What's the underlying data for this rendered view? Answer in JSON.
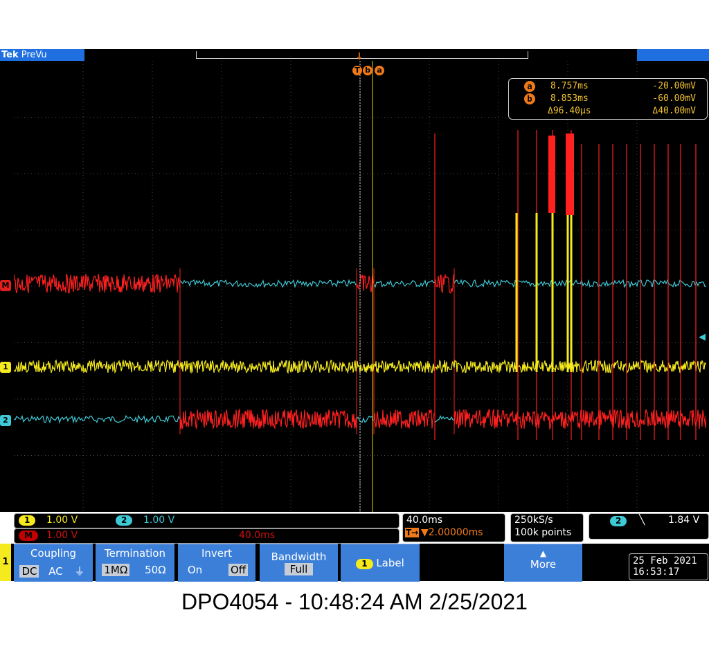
{
  "header": {
    "brand_tek": "Tek",
    "brand_mode": "PreVu"
  },
  "trigger_marker": {
    "label_t": "T",
    "cursor_b": "b",
    "cursor_a": "a"
  },
  "channel_markers": {
    "math": "M",
    "ch1": "1",
    "ch2": "2"
  },
  "cursor_readout": {
    "row_a": {
      "badge": "a",
      "time": "8.757ms",
      "volt": "-20.00mV"
    },
    "row_b": {
      "badge": "b",
      "time": "8.853ms",
      "volt": "-60.00mV"
    },
    "row_delta": {
      "time": "Δ96.40µs",
      "volt": "Δ40.00mV"
    }
  },
  "channel_info": {
    "ch1": {
      "badge": "1",
      "scale": "1.00 V"
    },
    "ch2": {
      "badge": "2",
      "scale": "1.00 V"
    },
    "math": {
      "badge": "M",
      "scale": "1.00 V",
      "time": "40.0ms"
    }
  },
  "timebase": {
    "scale": "40.0ms",
    "trigger_pos": "▼2.00000ms",
    "trigger_prefix": "T→"
  },
  "acquisition": {
    "rate": "250kS/s",
    "points": "100k points"
  },
  "trigger": {
    "channel": "2",
    "slope_icon": "╲",
    "level": "1.84 V"
  },
  "datetime": {
    "date": "25 Feb  2021",
    "time": "16:53:17"
  },
  "menu": {
    "channel_tab": "1",
    "coupling": {
      "title": "Coupling",
      "options": [
        "DC",
        "AC",
        "⏚"
      ],
      "selected": "DC"
    },
    "termination": {
      "title": "Termination",
      "options": [
        "1MΩ",
        "50Ω"
      ],
      "selected": "1MΩ"
    },
    "invert": {
      "title": "Invert",
      "options": [
        "On",
        "Off"
      ],
      "selected": "Off"
    },
    "bandwidth": {
      "title": "Bandwidth",
      "value": "Full"
    },
    "label": {
      "badge": "1",
      "text": "Label"
    },
    "more": {
      "text": "More"
    }
  },
  "footer": {
    "caption": "DPO4054 - 10:48:24 AM   2/25/2021"
  },
  "colors": {
    "ch1": "#f5ea1e",
    "ch2": "#3ec9d6",
    "math": "#ff2020",
    "cursor": "#f07a1a",
    "menu": "#3c7fd9"
  }
}
